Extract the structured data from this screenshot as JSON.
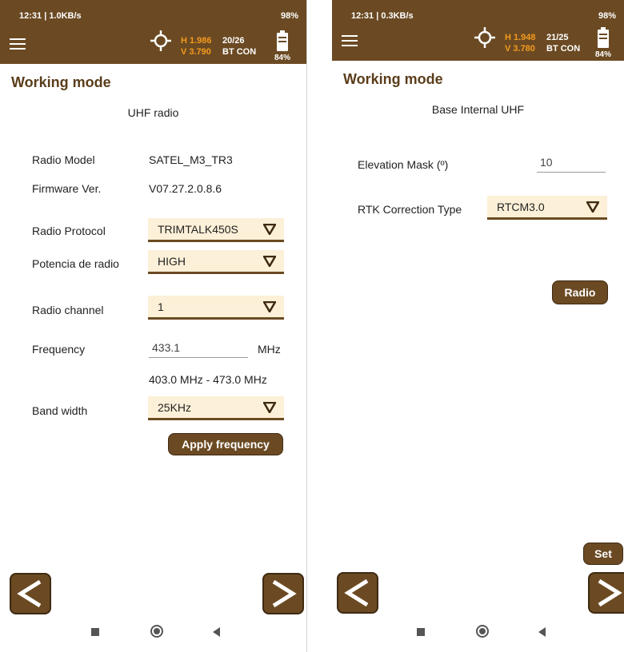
{
  "left": {
    "status": {
      "time": "12:31 | 1.0KB/s",
      "right": "98%"
    },
    "topbar": {
      "h": "H 1.986",
      "v": "V 3.790",
      "sats": "20/26",
      "bt": "BT CON",
      "battery": "84%"
    },
    "title": "Working mode",
    "subtitle": "UHF radio",
    "radio_model": {
      "label": "Radio Model",
      "value": "SATEL_M3_TR3"
    },
    "firmware": {
      "label": "Firmware Ver.",
      "value": "V07.27.2.0.8.6"
    },
    "protocol": {
      "label": "Radio Protocol",
      "value": "TRIMTALK450S"
    },
    "power": {
      "label": "Potencia de radio",
      "value": "HIGH"
    },
    "channel": {
      "label": "Radio channel",
      "value": "1"
    },
    "frequency": {
      "label": "Frequency",
      "value": "433.1",
      "unit": "MHz",
      "range": "403.0 MHz - 473.0 MHz"
    },
    "bandwidth": {
      "label": "Band width",
      "value": "25KHz"
    },
    "apply_button": "Apply frequency"
  },
  "right": {
    "status": {
      "time": "12:31 | 0.3KB/s",
      "right": "98%"
    },
    "topbar": {
      "h": "H 1.948",
      "v": "V 3.780",
      "sats": "21/25",
      "bt": "BT CON",
      "battery": "84%"
    },
    "title": "Working mode",
    "subtitle": "Base Internal UHF",
    "elevation": {
      "label": "Elevation Mask (º)",
      "value": "10"
    },
    "rtk": {
      "label": "RTK Correction Type",
      "value": "RTCM3.0"
    },
    "radio_button": "Radio",
    "set_button": "Set"
  },
  "icons": {
    "menu": "hamburger-icon",
    "gps": "crosshair-icon",
    "battery": "battery-icon",
    "prev": "chevron-left-icon",
    "next": "chevron-right-icon",
    "dropdown": "triangle-down-icon"
  },
  "colors": {
    "brand": "#6b4a23",
    "accent": "#f39a1d",
    "dropdown_bg": "#fdf0d8"
  }
}
